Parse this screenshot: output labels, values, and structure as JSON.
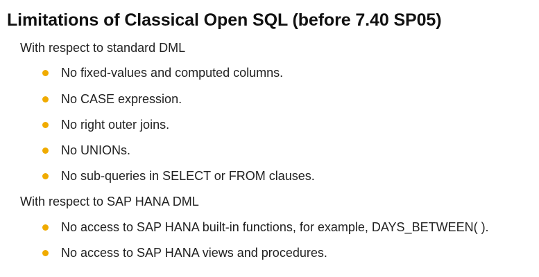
{
  "title": "Limitations of Classical Open SQL (before 7.40 SP05)",
  "colors": {
    "bullet": "#f0ab00",
    "text": "#222222"
  },
  "sections": [
    {
      "heading": "With respect to standard DML",
      "items": [
        "No fixed-values and computed columns.",
        "No CASE expression.",
        "No right outer joins.",
        "No UNIONs.",
        "No sub-queries in SELECT or FROM clauses."
      ]
    },
    {
      "heading": "With respect to SAP HANA DML",
      "items": [
        "No access to SAP HANA built-in functions, for example, DAYS_BETWEEN( ).",
        "No access to SAP HANA views and procedures."
      ]
    }
  ]
}
